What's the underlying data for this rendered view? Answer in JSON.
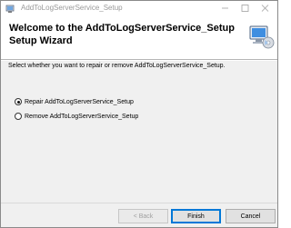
{
  "window": {
    "title": "AddToLogServerService_Setup"
  },
  "header": {
    "title": "Welcome to the AddToLogServerService_Setup Setup Wizard",
    "icon": "installer-computer-icon"
  },
  "body": {
    "description": "Select whether you want to repair or remove AddToLogServerService_Setup.",
    "options": [
      {
        "label": "Repair AddToLogServerService_Setup",
        "selected": true
      },
      {
        "label": "Remove AddToLogServerService_Setup",
        "selected": false
      }
    ]
  },
  "footer": {
    "back_label": "< Back",
    "finish_label": "Finish",
    "cancel_label": "Cancel"
  },
  "colors": {
    "default_button_border": "#0078d7",
    "disabled_text": "#a0a0a0"
  }
}
